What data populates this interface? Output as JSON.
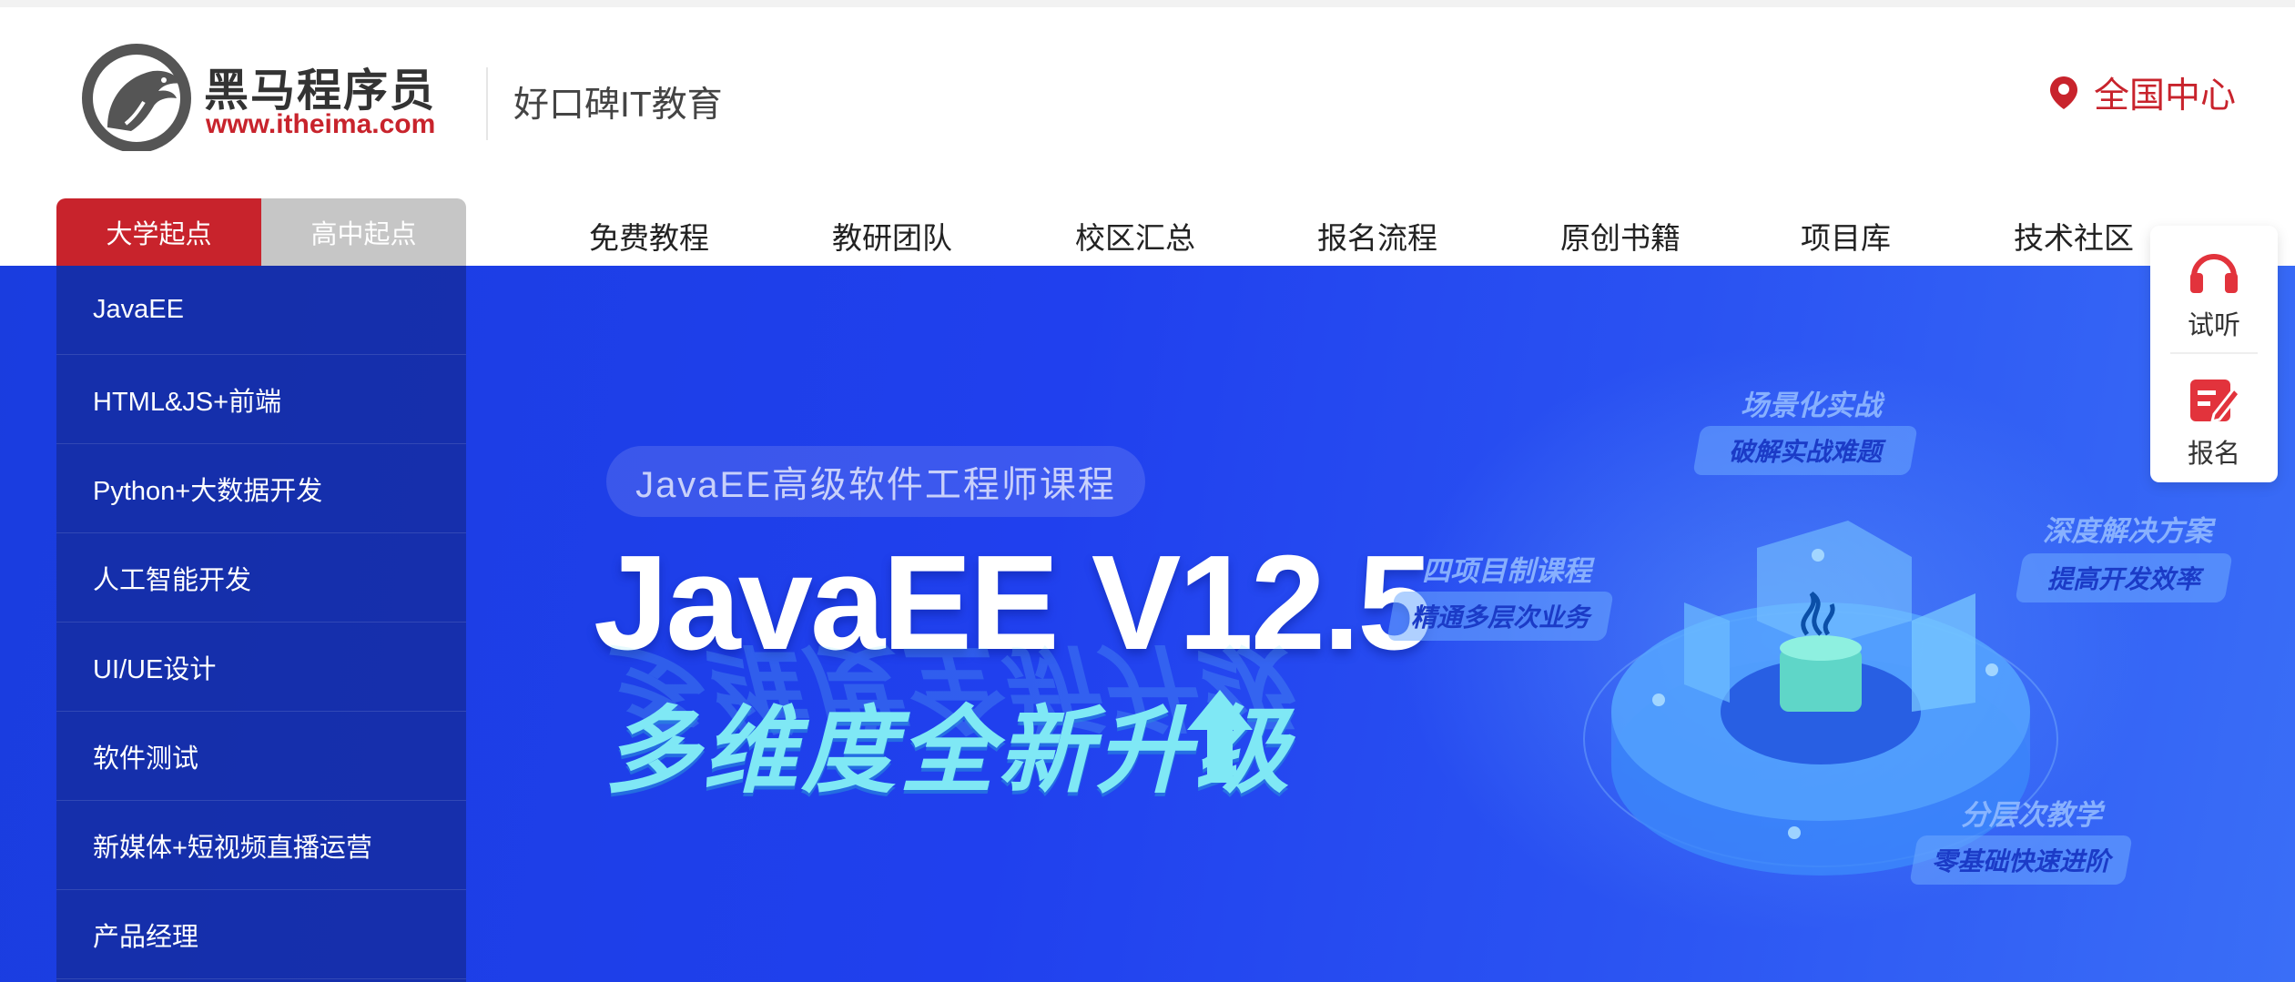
{
  "header": {
    "logo_text": "黑马程序员",
    "logo_url": "www.itheima.com",
    "slogan": "好口碑IT教育",
    "location": "全国中心",
    "location_icon": "map-pin-icon"
  },
  "start_tabs": [
    {
      "label": "大学起点",
      "active": true
    },
    {
      "label": "高中起点",
      "active": false
    }
  ],
  "nav": [
    "免费教程",
    "教研团队",
    "校区汇总",
    "报名流程",
    "原创书籍",
    "项目库",
    "技术社区"
  ],
  "sidebar": [
    "JavaEE",
    "HTML&JS+前端",
    "Python+大数据开发",
    "人工智能开发",
    "UI/UE设计",
    "软件测试",
    "新媒体+短视频直播运营",
    "产品经理"
  ],
  "banner": {
    "course_pill": "JavaEE高级软件工程师课程",
    "headline": "JavaEE V12.5",
    "subline": "多维度全新升级",
    "features": [
      {
        "title": "场景化实战",
        "badge": "破解实战难题"
      },
      {
        "title": "四项目制课程",
        "badge": "精通多层次业务"
      },
      {
        "title": "深度解决方案",
        "badge": "提高开发效率"
      },
      {
        "title": "分层次教学",
        "badge": "零基础快速进阶"
      }
    ]
  },
  "float_panel": [
    {
      "label": "试听",
      "icon": "headphones-icon"
    },
    {
      "label": "报名",
      "icon": "signup-edit-icon"
    }
  ],
  "colors": {
    "brand_red": "#c8232c",
    "banner_blue": "#2040ee",
    "cyan_text": "#7fe8f5"
  }
}
